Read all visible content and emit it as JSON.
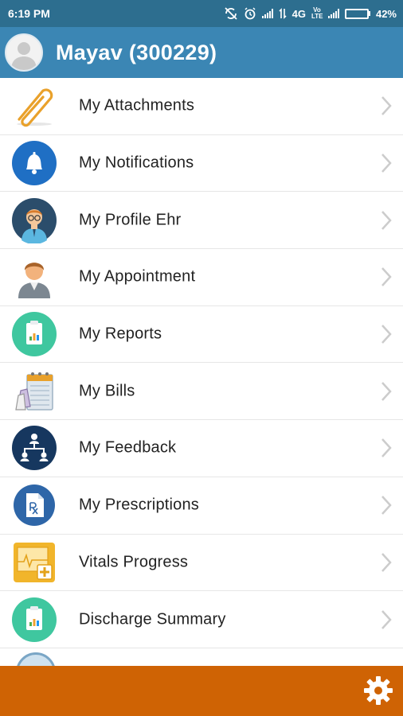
{
  "status_bar": {
    "time": "6:19 PM",
    "network": "4G",
    "volte": "Vo LTE",
    "battery_text": "42%",
    "battery_level": 0.42,
    "icons": [
      "sync-off-icon",
      "alarm-icon",
      "signal-icon",
      "data-arrows-icon",
      "volte-icon",
      "signal-icon",
      "battery-icon"
    ]
  },
  "header": {
    "title": "Mayav (300229)",
    "avatar_icon": "user-silhouette-icon"
  },
  "menu": {
    "items": [
      {
        "label": "My Attachments",
        "icon": "paperclip-icon"
      },
      {
        "label": "My Notifications",
        "icon": "bell-icon"
      },
      {
        "label": "My Profile Ehr",
        "icon": "doctor-profile-icon"
      },
      {
        "label": "My Appointment",
        "icon": "person-icon"
      },
      {
        "label": "My Reports",
        "icon": "clipboard-chart-icon"
      },
      {
        "label": "My Bills",
        "icon": "calendar-bills-icon"
      },
      {
        "label": "My Feedback",
        "icon": "people-network-icon"
      },
      {
        "label": "My Prescriptions",
        "icon": "rx-document-icon"
      },
      {
        "label": "Vitals Progress",
        "icon": "vitals-monitor-icon"
      },
      {
        "label": "Discharge Summary",
        "icon": "clipboard-chart-icon"
      }
    ],
    "chevron_icon": "chevron-right-icon"
  },
  "bottom_bar": {
    "settings_icon": "gear-icon"
  },
  "colors": {
    "status_bar": "#2d6e8f",
    "header": "#3b86b4",
    "bottom_bar": "#cf6304",
    "text": "#222222",
    "chevron": "#cccccc"
  }
}
